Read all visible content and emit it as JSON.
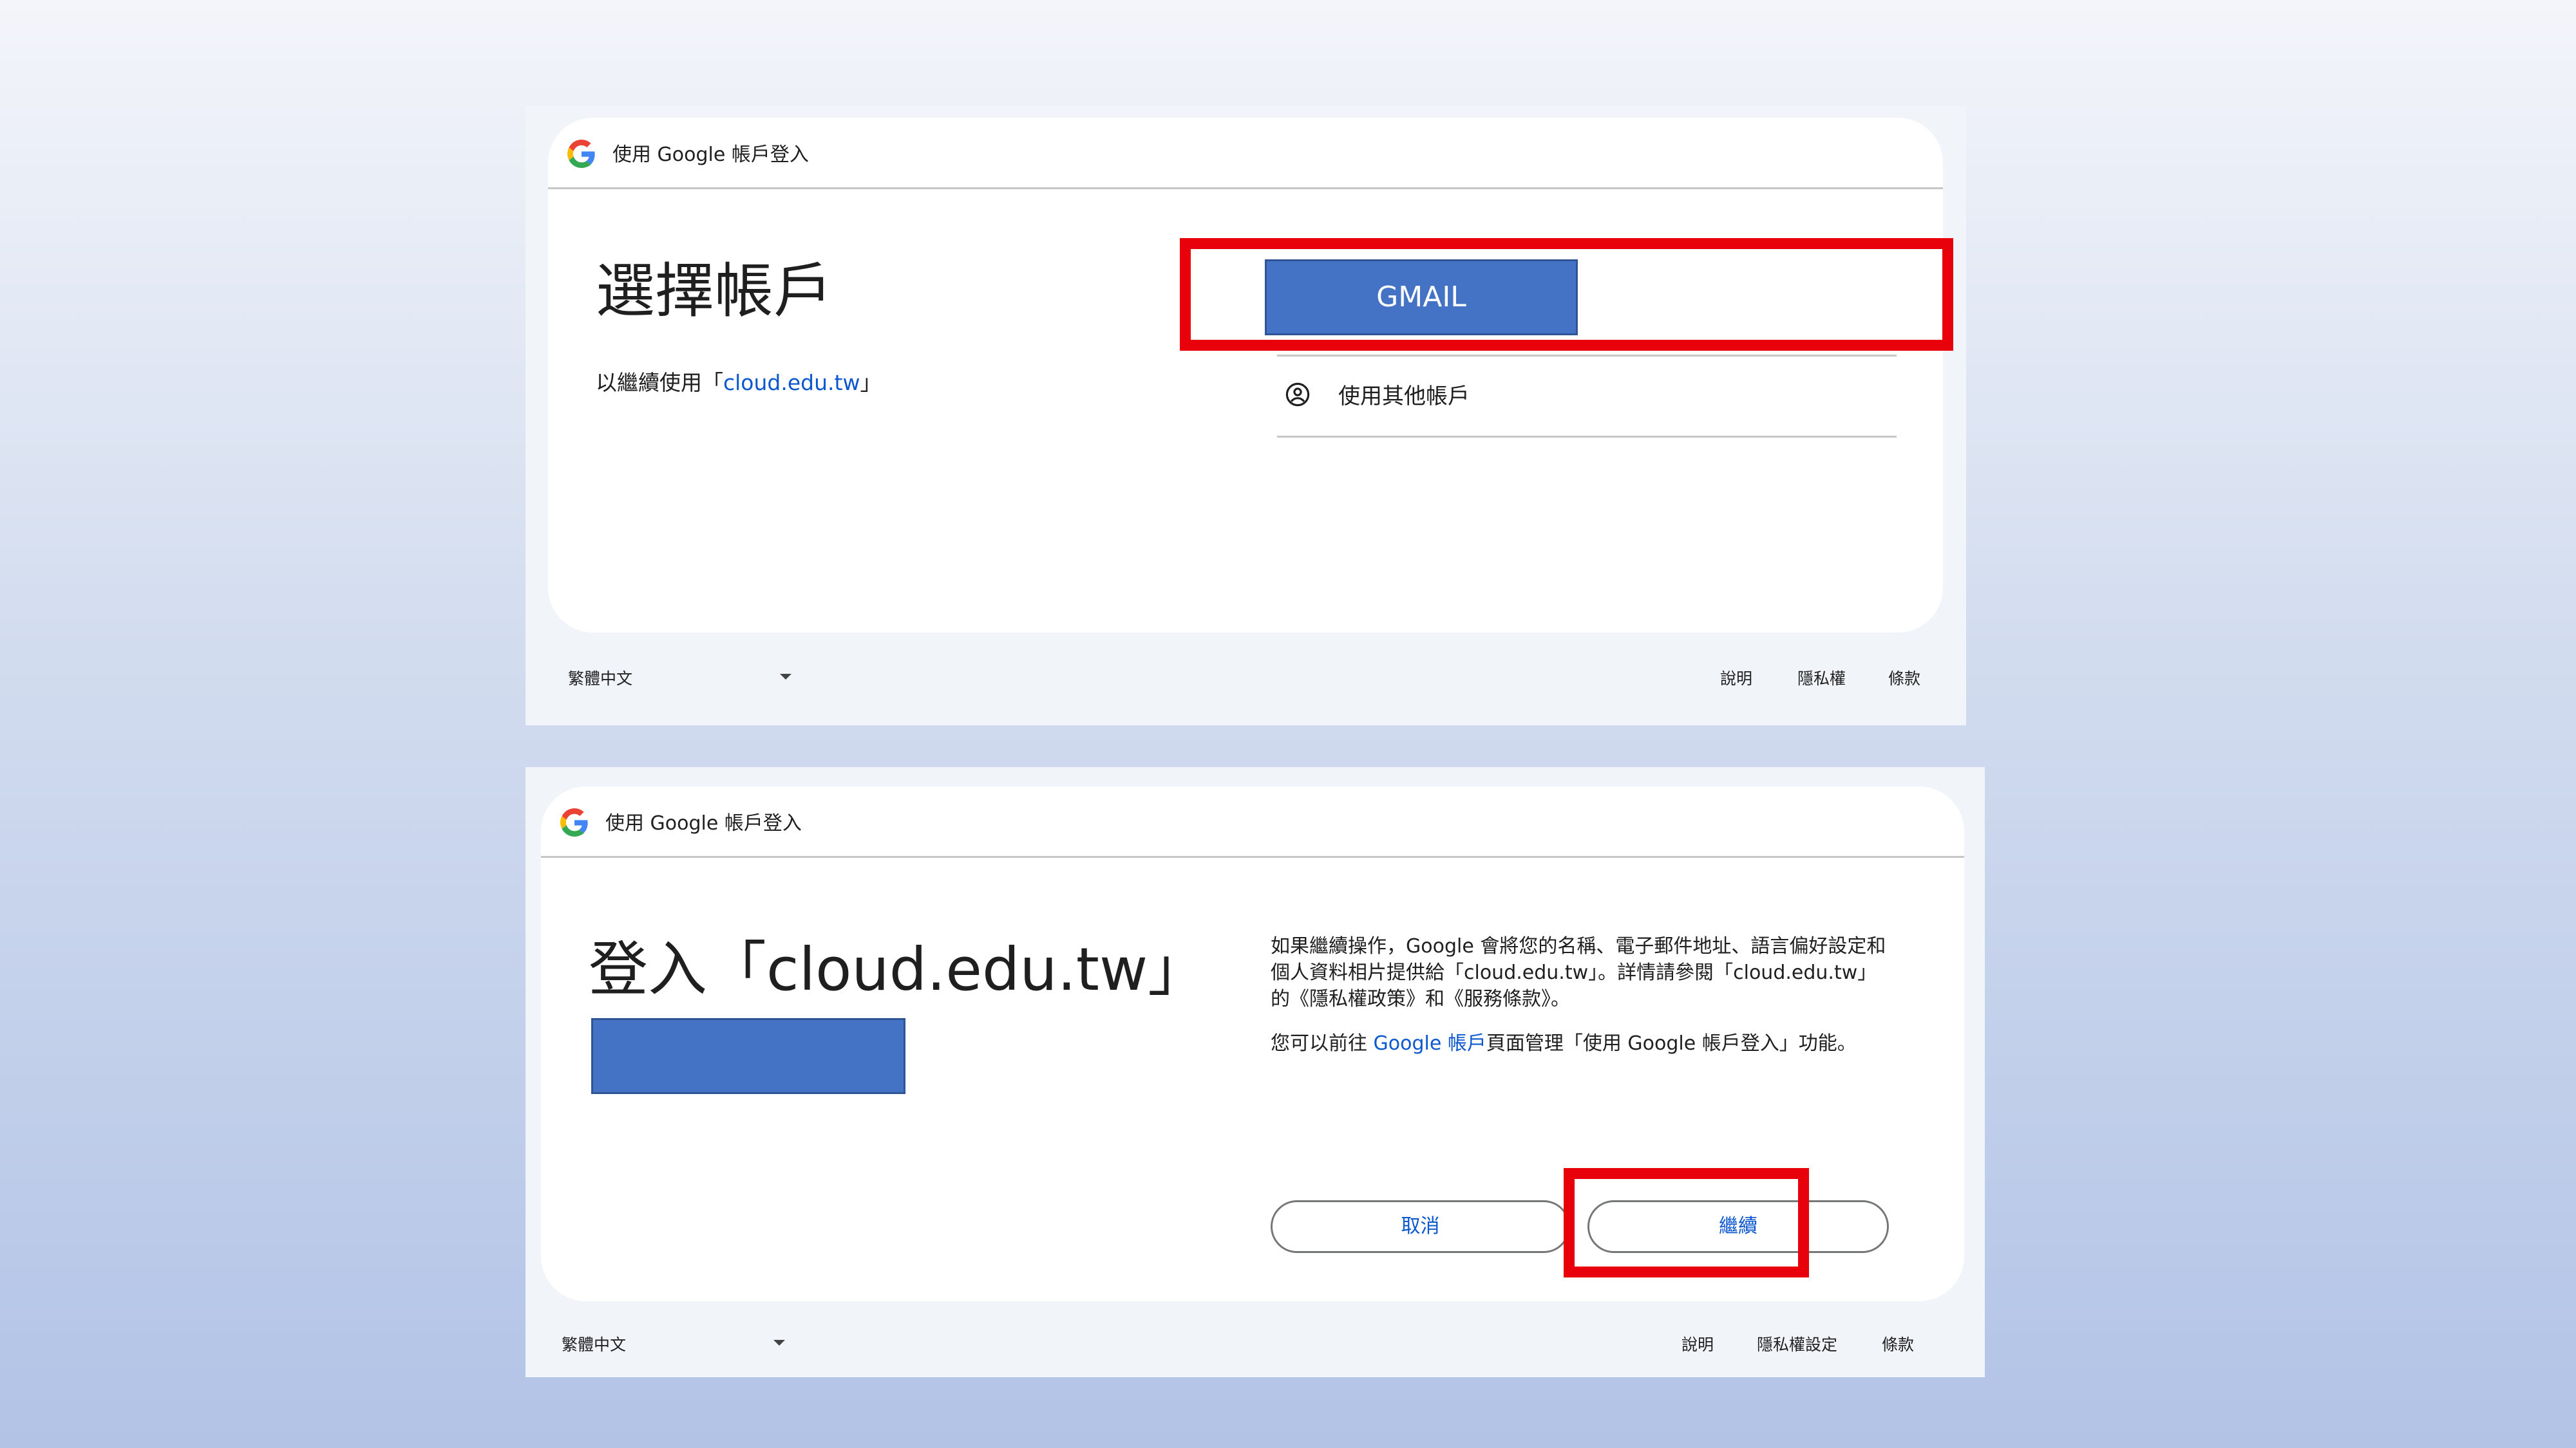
{
  "screen1": {
    "header_title": "使用 Google 帳戶登入",
    "title": "選擇帳戶",
    "subtitle_prefix": "以繼續使用「",
    "subtitle_link": "cloud.edu.tw",
    "subtitle_suffix": "」",
    "gmail_label": "GMAIL",
    "other_account_label": "使用其他帳戶",
    "footer": {
      "language": "繁體中文",
      "help": "說明",
      "privacy": "隱私權",
      "terms": "條款"
    }
  },
  "screen2": {
    "header_title": "使用 Google 帳戶登入",
    "title": "登入「cloud.edu.tw」",
    "consent_p1": "如果繼續操作，Google 會將您的名稱、電子郵件地址、語言偏好設定和個人資料相片提供給「cloud.edu.tw」。詳情請參閱「cloud.edu.tw」的《隱私權政策》和《服務條款》。",
    "consent_p2_prefix": "您可以前往 ",
    "consent_p2_link": "Google 帳戶",
    "consent_p2_suffix": "頁面管理「使用 Google 帳戶登入」功能。",
    "cancel_label": "取消",
    "continue_label": "繼續",
    "footer": {
      "language": "繁體中文",
      "help": "說明",
      "privacy": "隱私權設定",
      "terms": "條款"
    }
  },
  "colors": {
    "highlight": "#e8000b",
    "mask": "#4472c4",
    "link": "#0b57d0"
  },
  "icons": [
    "google-logo-icon",
    "account-circle-icon",
    "caret-down-icon"
  ]
}
